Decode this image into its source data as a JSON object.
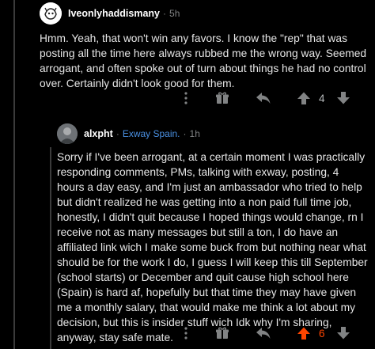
{
  "comments": [
    {
      "username": "Iveonlyhaddismany",
      "flair": "",
      "time": "5h",
      "body": "Hmm. Yeah, that won't win any favors. I know the \"rep\" that was posting all the time here always rubbed me the wrong way. Seemed arrogant, and often spoke out of turn about things he had no control over. Certainly didn't look good for them.",
      "score": "4",
      "upvoted": false
    },
    {
      "username": "alxpht",
      "flair": "Exway Spain.",
      "time": "1h",
      "body": "Sorry if I've been arrogant, at a certain moment I was practically responding comments, PMs, talking with exway, posting, 4 hours a day easy, and I'm just an ambassador who tried to help but didn't realized he was getting into a non paid full time job, honestly, I didn't quit because I hoped things would change, rn I receive not as many messages but still a ton, I do have an affiliated link wich I make some buck from but nothing near what should be for the work I do, I guess I will keep this till September (school starts) or December and quit cause high school here (Spain) is hard af, hopefully but that time they may have given me a monthly salary, that would make me think a lot about my decision, but this is insider stuff wich Idk why I'm sharing, anyway, stay safe mate.",
      "score": "6",
      "upvoted": true
    }
  ],
  "separator": "·",
  "icons": [
    "more-icon",
    "award-icon",
    "reply-icon",
    "upvote-icon",
    "downvote-icon"
  ],
  "colors": {
    "background": "#000000",
    "text": "#e6e6e6",
    "upvote_active": "#ff4500",
    "flair": "#4a90e2"
  }
}
